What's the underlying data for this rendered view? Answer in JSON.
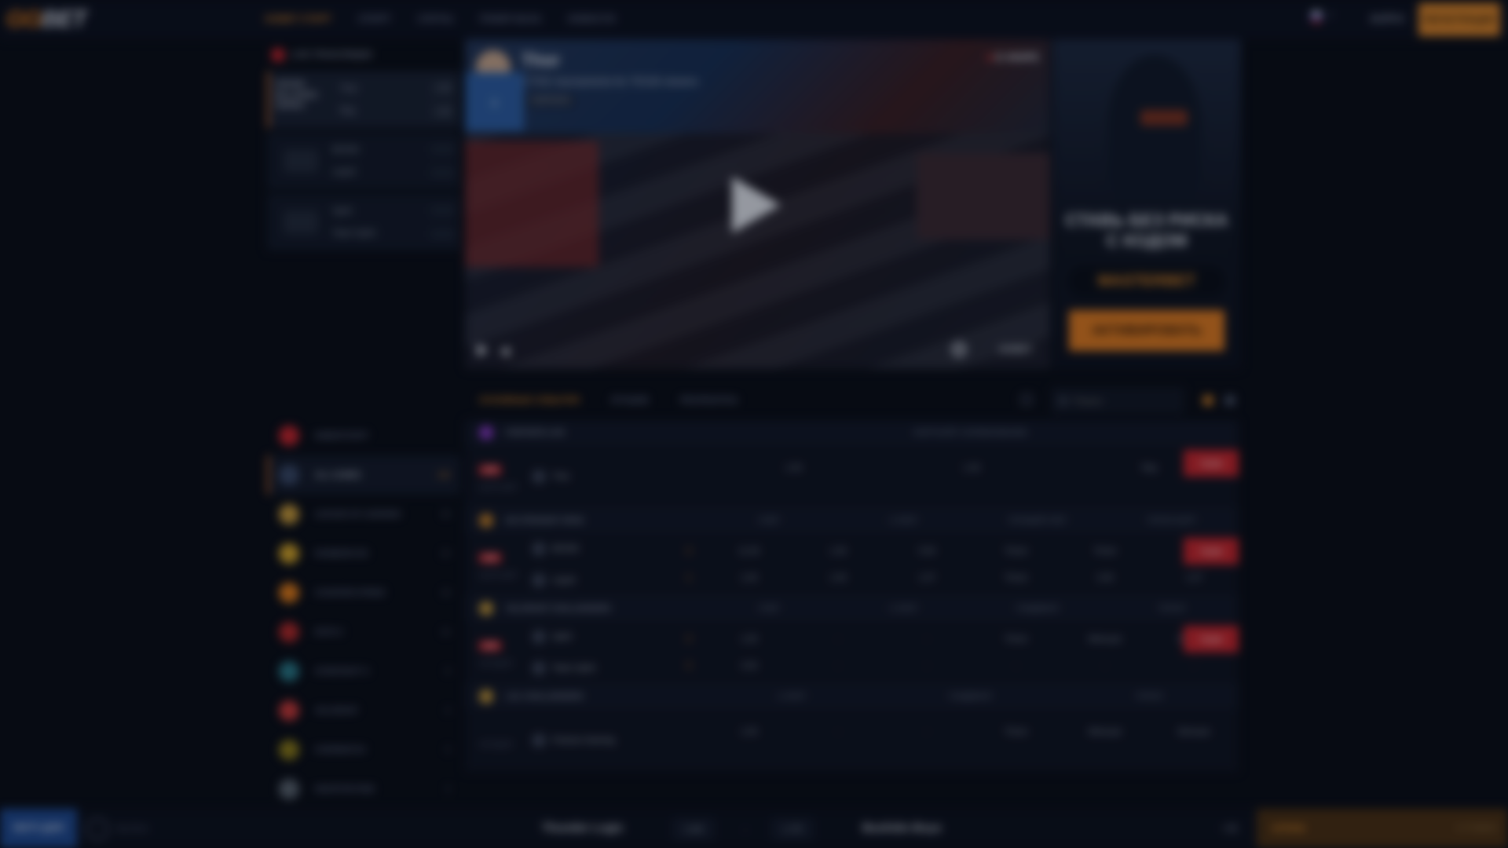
{
  "header": {
    "logo_part1": "GG",
    "logo_part2": "BET",
    "nav": [
      "GGBET СТАРТ",
      "СПОРТ",
      "СЛОТЫ",
      "ПОКЕР-БАЗА",
      "НОВОСТИ"
    ],
    "login": "ВОЙТИ",
    "register": "РЕГИСТРАЦИЯ"
  },
  "streams": {
    "heading": "LIVE ТРАНСЛЯЦИИ",
    "cards": [
      {
        "tournament": "GRAND BILLIARDS SERIES",
        "team1": "Thor",
        "team2": "Ray",
        "odd1": "1.00",
        "odd2": "1.00"
      },
      {
        "tournament": "",
        "team1": "BOOM",
        "team2": "Liquid",
        "odd1": "",
        "odd2": ""
      },
      {
        "tournament": "",
        "team1": "Spirit",
        "team2": "Team Spirit",
        "odd1": "",
        "odd2": ""
      }
    ]
  },
  "video": {
    "streamer": "Thor",
    "title": "5 TVS: tournaments for 75/100 viewers",
    "tag": "FORTNITE",
    "live": "В ЭФИРЕ",
    "brand": "GGBET"
  },
  "promo": {
    "title": "СТАВЬ БЕЗ РИСКА С КОДОМ",
    "code": "MASTERBET",
    "button": "АКТИВИРОВАТЬ"
  },
  "tabs": [
    "ОСНОВНЫЕ СОБЫТИЯ",
    "ЛУЧШИЕ",
    "РЕЗУЛЬТАТЫ"
  ],
  "search": {
    "placeholder": "Поиск"
  },
  "sports": [
    {
      "label": "Киберспорт",
      "count": "",
      "color": "#c8262e"
    },
    {
      "label": "ALL GAMES",
      "count": "130",
      "color": "#3a4a6a"
    },
    {
      "label": "League of Legends",
      "count": "30",
      "color": "#c89b3c"
    },
    {
      "label": "Rainbow Six",
      "count": "20",
      "color": "#d4a52a"
    },
    {
      "label": "Counter-Strike",
      "count": "18",
      "color": "#e07b1a"
    },
    {
      "label": "Dota 2",
      "count": "16",
      "color": "#b22a2a"
    },
    {
      "label": "StarCraft 2",
      "count": "8",
      "color": "#2a7a8a"
    },
    {
      "label": "Valorant",
      "count": "6",
      "color": "#c83a3a"
    },
    {
      "label": "Overwatch",
      "count": "5",
      "color": "#8a7a1a"
    },
    {
      "label": "Hearthstone",
      "count": "3",
      "color": "#5a6470"
    }
  ],
  "events": [
    {
      "group": "FORTNITE LIVE",
      "group_color": "#8a3ac8",
      "cols": [
        "ФОРТНАЙТ СОРЕВНОВАНИЕ"
      ],
      "rows": [
        {
          "live": "LIVE",
          "time": "Фортнайт",
          "team1": "Thor",
          "team2": "",
          "score1": "",
          "score2": "",
          "odds": [
            [
              "1.00",
              ""
            ],
            [
              "1.00",
              ""
            ],
            [
              "Ray",
              ""
            ]
          ],
          "stream": "Стрим"
        }
      ]
    },
    {
      "group": "NO STRAIGHT SPAN",
      "group_color": "#c8822a",
      "cols": [
        "СЧЕТ",
        "1 СЛОТ",
        "ТОЧНЫЙ СЧЕТ",
        "ТОТАЛ КАРТ"
      ],
      "rows": [
        {
          "live": "LIVE",
          "time": "Фортнайт",
          "team1": "BOOM",
          "team2": "Liquid",
          "score1": "0",
          "score2": "1",
          "odds": [
            [
              "11.00",
              "1.00"
            ],
            [
              "1.00",
              "1.00"
            ],
            [
              "5.00",
              "1.07"
            ],
            [
              "Тотал",
              "Тотал"
            ],
            [
              "Тотал",
              "3.00"
            ],
            [
              "Фора",
              "1.07"
            ]
          ],
          "stream": "Стрим"
        }
      ]
    },
    {
      "group": "VALORANT CHALLENGERS",
      "group_color": "#c89b3c",
      "cols": [
        "СЧЕТ",
        "1 СЛОТ",
        "ГАНДИКАП",
        "ТОТАЛ"
      ],
      "rows": [
        {
          "live": "LIVE",
          "time": "Сегодня",
          "team1": "Spirit",
          "team2": "Team Spirit",
          "score1": "0",
          "score2": "0",
          "odds": [
            [
              "1.00",
              "3.00"
            ],
            [
              "-",
              "-"
            ],
            [
              "-",
              "-"
            ],
            [
              "Тотал",
              "-"
            ],
            [
              "Меньше",
              "-"
            ],
            [
              "Больше",
              "-"
            ]
          ],
          "stream": "Стрим"
        }
      ]
    },
    {
      "group": "LOL CHALLENGERS",
      "group_color": "#c89b3c",
      "cols": [
        "1 СЛОТ",
        "ГАНДИКАП",
        "ТОТАЛ"
      ],
      "rows": [
        {
          "live": "",
          "time": "Сегодня",
          "team1": "Fortune Gaming",
          "team2": "",
          "score1": "",
          "score2": "",
          "odds": [
            [
              "1.00",
              ""
            ],
            [
              "-",
              ""
            ],
            [
              "-",
              ""
            ],
            [
              "Тотал",
              ""
            ],
            [
              "Меньше",
              ""
            ],
            [
              "Больше",
              ""
            ]
          ],
          "stream": ""
        }
      ]
    }
  ],
  "bottom": {
    "motd": "МАТЧ ДНЯ",
    "sport": "Футбол",
    "home": "Thunder Logic",
    "odd_home": "1.64",
    "odd_draw": "-",
    "odd_away": "1.70",
    "away": "Bushido Boys",
    "count": "+38",
    "coupon": "КУПОН",
    "coupon_count": "0 СТАВОК"
  }
}
